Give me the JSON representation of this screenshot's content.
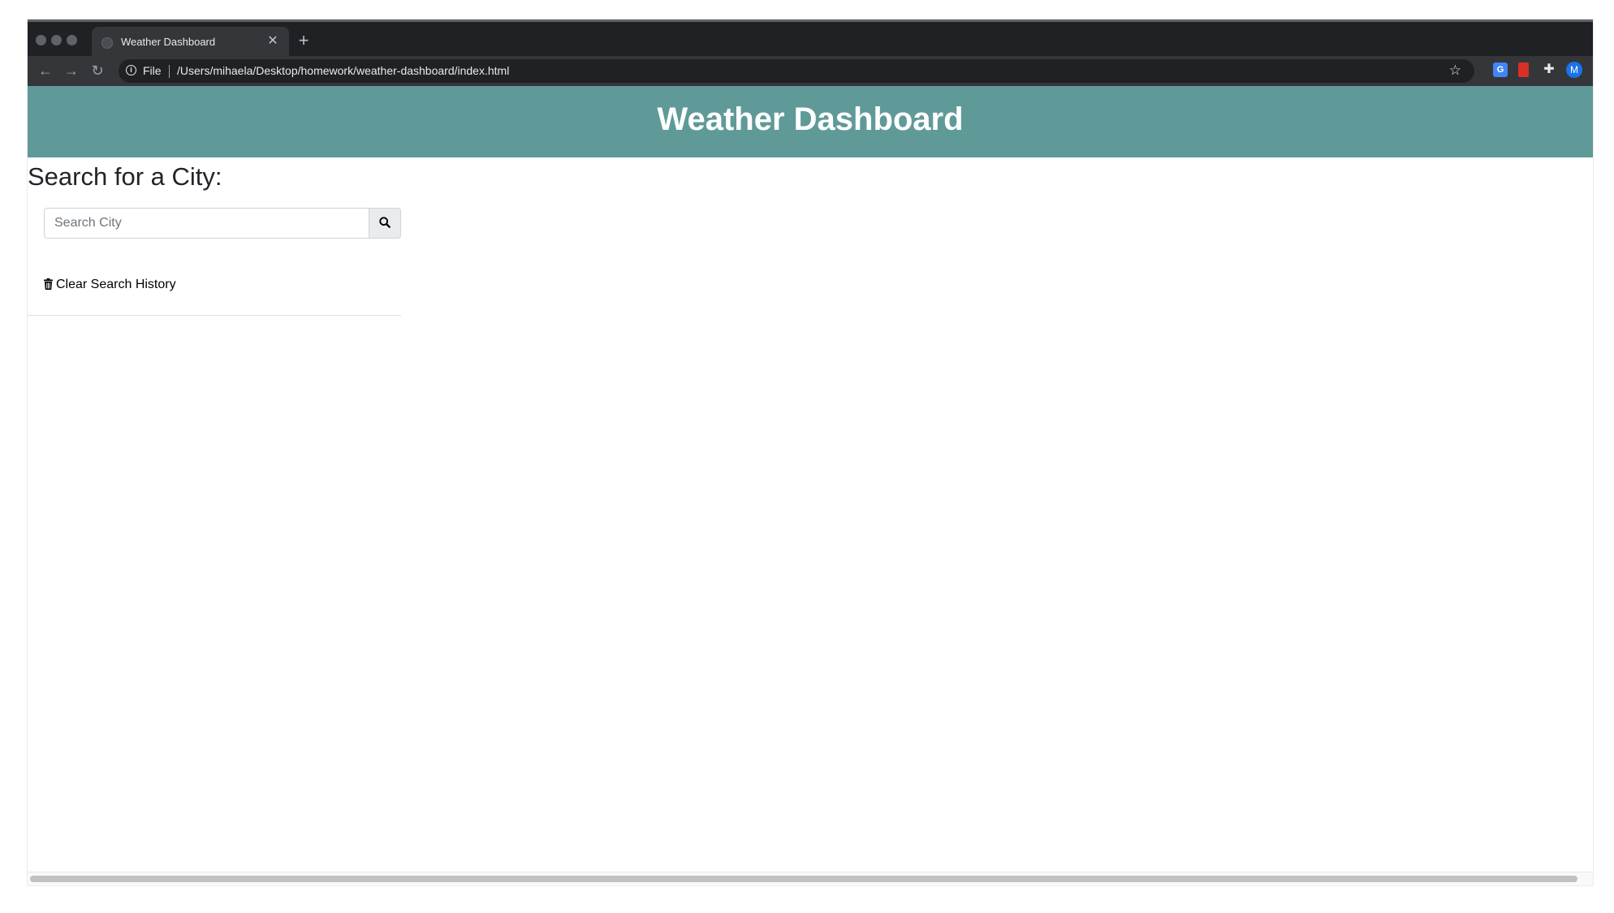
{
  "browser": {
    "tab": {
      "title": "Weather Dashboard",
      "close_icon": "close-icon"
    },
    "new_tab_icon": "plus-icon",
    "omnibox": {
      "scheme": "File",
      "url": "/Users/mihaela/Desktop/homework/weather-dashboard/index.html"
    },
    "profile_initial": "M"
  },
  "page": {
    "header_title": "Weather Dashboard",
    "header_color": "#5f9a98",
    "search_heading": "Search for a City:",
    "search_placeholder": "Search City",
    "search_value": "",
    "clear_history_label": "Clear Search History"
  }
}
